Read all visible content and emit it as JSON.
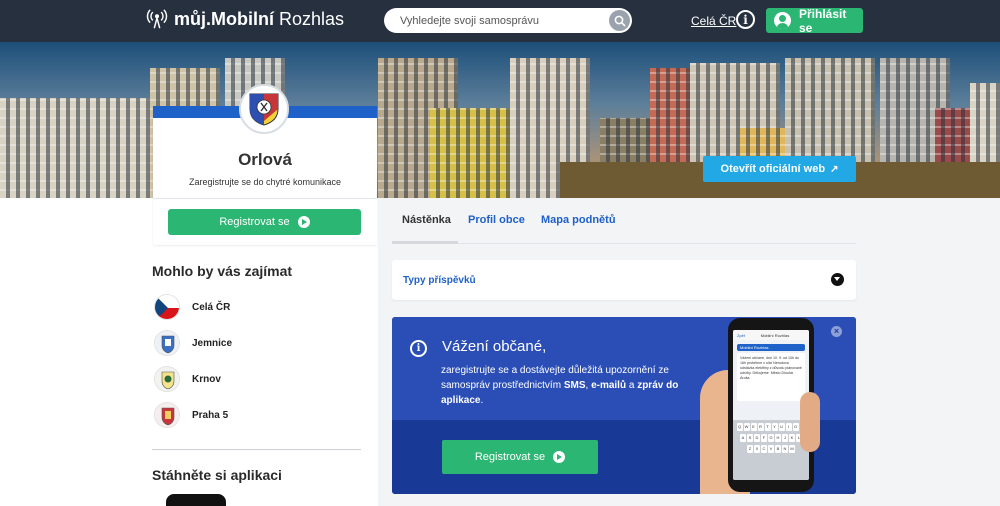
{
  "header": {
    "brand_bold": "můj.Mobilní",
    "brand_regular": "Rozhlas",
    "search_placeholder": "Vyhledejte svoji samosprávu",
    "link_country": "Celá ČR",
    "info_glyph": "i",
    "login_label": "Přihlásit se"
  },
  "profile": {
    "city": "Orlová",
    "subtitle": "Zaregistrujte se do chytré komunikace",
    "register_label": "Registrovat se",
    "official_web_label": "Otevřít oficiální web"
  },
  "interest": {
    "title": "Mohlo by vás zajímat",
    "items": [
      {
        "label": "Celá ČR",
        "icon": "czech-flag-icon"
      },
      {
        "label": "Jemnice",
        "icon": "jemnice-crest-icon"
      },
      {
        "label": "Krnov",
        "icon": "krnov-crest-icon"
      },
      {
        "label": "Praha 5",
        "icon": "praha5-crest-icon"
      }
    ]
  },
  "apps": {
    "title": "Stáhněte si aplikaci"
  },
  "tabs": [
    {
      "label": "Nástěnka",
      "active": true
    },
    {
      "label": "Profil obce",
      "active": false
    },
    {
      "label": "Mapa podnětů",
      "active": false
    }
  ],
  "post_types": {
    "label": "Typy příspěvků"
  },
  "banner": {
    "title": "Vážení občané,",
    "text_1": "zaregistrujte se a dostávejte důležitá upozornění ze samospráv prostřednictvím",
    "sms": "SMS",
    "sep": ",",
    "emails": "e-mailů",
    "and": "a",
    "app_msgs": "zpráv do aplikace",
    "end": ".",
    "register_label": "Registrovat se",
    "close_glyph": "×",
    "info_glyph": "i",
    "phone_app_title": "Mobilní Rozhlas",
    "phone_back": "Zpět",
    "phone_msg": "Vážení občané, dne 10. 9. od 10h do 16h proběhne v ulici Nerudova odstávka elektřiny z důvodu plánované údržby. Děkujeme. Město Dlouhá Ároša."
  },
  "colors": {
    "topbar": "#26303f",
    "green": "#2bb673",
    "blue_link": "#1e61c8",
    "banner": "#1a3d9c",
    "official_btn": "#23a8e6"
  }
}
